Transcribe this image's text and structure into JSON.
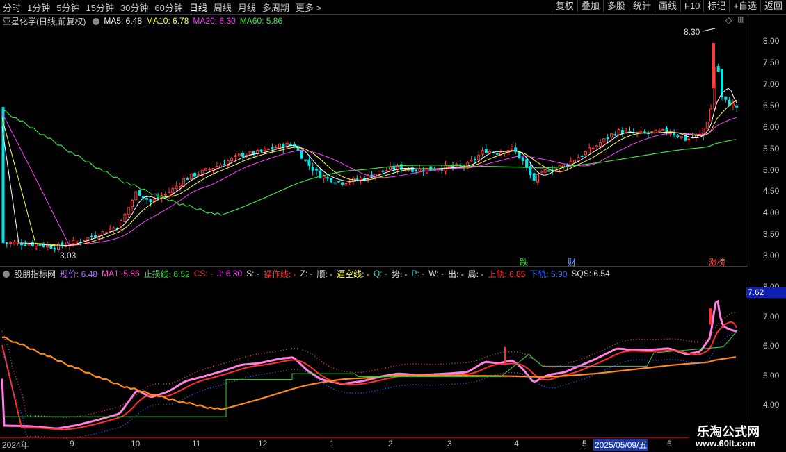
{
  "toolbar": {
    "periods": [
      "分时",
      "1分钟",
      "5分钟",
      "15分钟",
      "30分钟",
      "60分钟",
      "日线",
      "周线",
      "月线",
      "多周期",
      "更多 >"
    ],
    "active_period": "日线",
    "buttons": [
      "复权",
      "叠加",
      "多股",
      "统计",
      "画线",
      "F10",
      "标记",
      "+自选",
      "返回"
    ]
  },
  "main_panel": {
    "stock_title": "亚星化学(日线,前复权)",
    "ma5": "MA5: 6.48",
    "ma10": "MA10: 6.78",
    "ma20": "MA20: 6.30",
    "ma60": "MA60: 5.86",
    "high_label": "8.30",
    "low_label": "3.03",
    "event_labels": [
      "跌",
      "财",
      "涨榜"
    ],
    "y_ticks": [
      "8.00",
      "7.50",
      "7.00",
      "6.50",
      "6.00",
      "5.50",
      "5.00",
      "4.50",
      "4.00",
      "3.50",
      "3.00"
    ]
  },
  "indicator_panel": {
    "name": "股朋指标网",
    "fields": [
      {
        "text": "现价: 6.48",
        "color": "#b070ff"
      },
      {
        "text": "MA1: 5.86",
        "color": "#ff4ad0"
      },
      {
        "text": "止损线: 6.52",
        "color": "#40d040"
      },
      {
        "text": "CS: -",
        "color": "#ff3030"
      },
      {
        "text": "J: 6.30",
        "color": "#ff40ff"
      },
      {
        "text": "S: -",
        "color": "#e0e0e0"
      },
      {
        "text": "操作线: -",
        "color": "#ff3030"
      },
      {
        "text": "Z: -",
        "color": "#e0e0e0"
      },
      {
        "text": "顺: -",
        "color": "#e0e0e0"
      },
      {
        "text": "逼空线: -",
        "color": "#ffff40"
      },
      {
        "text": "Q: -",
        "color": "#40d0d0"
      },
      {
        "text": "势: -",
        "color": "#e0e0e0"
      },
      {
        "text": "P: -",
        "color": "#40d0d0"
      },
      {
        "text": "W: -",
        "color": "#e0e0e0"
      },
      {
        "text": "出: -",
        "color": "#e0e0e0"
      },
      {
        "text": "局: -",
        "color": "#e0e0e0"
      },
      {
        "text": "上轨: 6.85",
        "color": "#ff3030"
      },
      {
        "text": "下轨: 5.90",
        "color": "#4070ff"
      },
      {
        "text": "SQS: 6.54",
        "color": "#e0e0e0"
      }
    ],
    "y_ticks": [
      "8.00",
      "7.00",
      "6.00",
      "5.00",
      "4.00"
    ],
    "price_tag": "7.62"
  },
  "date_axis": {
    "labels": [
      "2024年",
      "9",
      "10",
      "11",
      "12",
      "1",
      "2",
      "3",
      "4",
      "5",
      "6"
    ],
    "highlight": "2025/05/09/五"
  },
  "watermark": {
    "line1": "乐淘公式网",
    "line2": "www.60lt.com"
  },
  "colors": {
    "up": "#ff3b3b",
    "down": "#00e8e8",
    "ma5": "#ffffff",
    "ma10": "#ffff40",
    "ma20": "#ff40ff",
    "ma60": "#40e040",
    "orange": "#ff8c1a",
    "pink": "#ff80e0",
    "blue": "#4070ff",
    "red": "#ff3030",
    "green": "#40d040"
  }
}
